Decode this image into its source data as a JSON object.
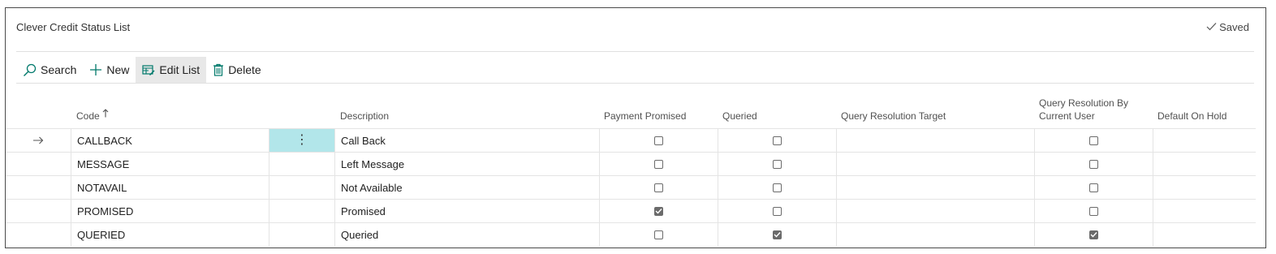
{
  "page": {
    "title": "Clever Credit Status List",
    "saved_label": "Saved"
  },
  "toolbar": {
    "search_label": "Search",
    "new_label": "New",
    "edit_list_label": "Edit List",
    "delete_label": "Delete"
  },
  "table": {
    "columns": {
      "code": "Code",
      "description": "Description",
      "payment_promised": "Payment Promised",
      "queried": "Queried",
      "query_resolution_target": "Query Resolution Target",
      "query_resolution_by_line1": "Query Resolution By",
      "query_resolution_by_line2": "Current User",
      "default_on_hold": "Default On Hold"
    },
    "rows": [
      {
        "code": "CALLBACK",
        "description": "Call Back",
        "payment_promised": false,
        "queried": false,
        "query_resolution_target": "",
        "query_resolution_by_current_user": false,
        "default_on_hold": "",
        "selected": true
      },
      {
        "code": "MESSAGE",
        "description": "Left Message",
        "payment_promised": false,
        "queried": false,
        "query_resolution_target": "",
        "query_resolution_by_current_user": false,
        "default_on_hold": "",
        "selected": false
      },
      {
        "code": "NOTAVAIL",
        "description": "Not Available",
        "payment_promised": false,
        "queried": false,
        "query_resolution_target": "",
        "query_resolution_by_current_user": false,
        "default_on_hold": "",
        "selected": false
      },
      {
        "code": "PROMISED",
        "description": "Promised",
        "payment_promised": true,
        "queried": false,
        "query_resolution_target": "",
        "query_resolution_by_current_user": false,
        "default_on_hold": "",
        "selected": false
      },
      {
        "code": "QUERIED",
        "description": "Queried",
        "payment_promised": false,
        "queried": true,
        "query_resolution_target": "",
        "query_resolution_by_current_user": true,
        "default_on_hold": "",
        "selected": false
      }
    ]
  },
  "icons": {
    "search": "search-icon",
    "new": "plus-icon",
    "edit_list": "edit-list-icon",
    "delete": "trash-icon",
    "saved": "checkmark-icon",
    "sort": "sort-ascending-icon",
    "row_pointer": "right-arrow-icon",
    "row_menu": "more-options-icon"
  },
  "colors": {
    "accent": "#00796b",
    "selected_cell": "#b2e6ea",
    "checkbox_checked": "#6b6b6b",
    "toolbar_active": "#e8e8e8"
  }
}
